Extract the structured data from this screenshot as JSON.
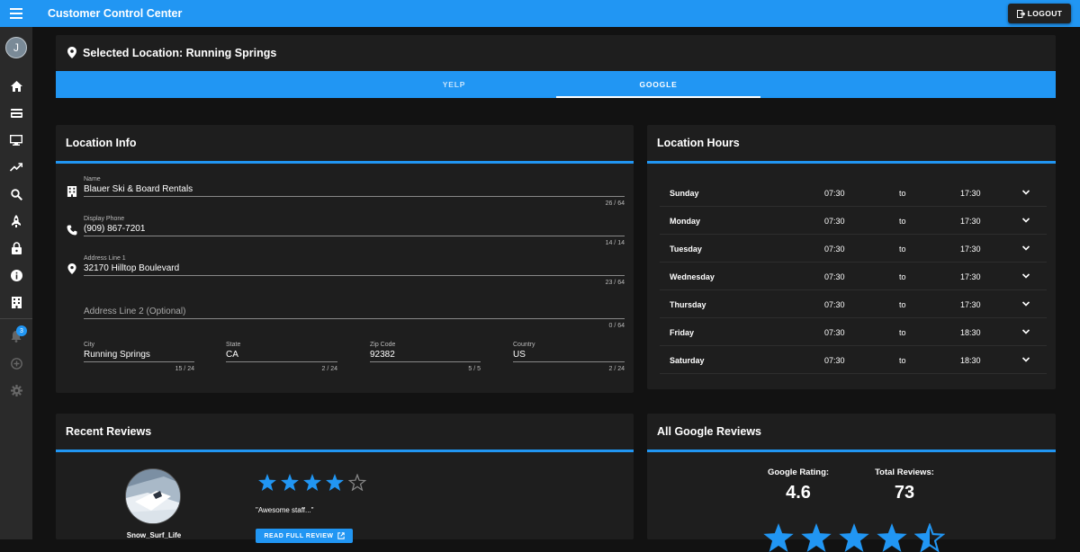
{
  "header": {
    "title": "Customer Control Center",
    "logout_label": "LOGOUT"
  },
  "sidebar": {
    "avatar_initial": "J",
    "notification_count": "3",
    "items": [
      "home-icon",
      "card-icon",
      "monitor-icon",
      "trending-up-icon",
      "search-icon",
      "rocket-icon",
      "lock-icon",
      "info-icon",
      "building-icon",
      "bell-icon",
      "plus-circle-icon",
      "gear-icon"
    ]
  },
  "selected_location": {
    "title": "Selected Location: Running Springs"
  },
  "tabs": [
    {
      "label": "YELP"
    },
    {
      "label": "GOOGLE"
    }
  ],
  "location_info": {
    "title": "Location Info",
    "name": {
      "label": "Name",
      "value": "Blauer Ski & Board Rentals",
      "count": "26 / 64"
    },
    "phone": {
      "label": "Display Phone",
      "value": "(909) 867-7201",
      "count": "14 / 14"
    },
    "address1": {
      "label": "Address Line 1",
      "value": "32170 Hilltop Boulevard",
      "count": "23 / 64"
    },
    "address2": {
      "placeholder": "Address Line 2 (Optional)",
      "count": "0 / 64"
    },
    "city": {
      "label": "City",
      "value": "Running Springs",
      "count": "15 / 24"
    },
    "state": {
      "label": "State",
      "value": "CA",
      "count": "2 / 24"
    },
    "zip": {
      "label": "Zip Code",
      "value": "92382",
      "count": "5 / 5"
    },
    "country": {
      "label": "Country",
      "value": "US",
      "count": "2 / 24"
    }
  },
  "location_hours": {
    "title": "Location Hours",
    "to_label": "to",
    "rows": [
      {
        "day": "Sunday",
        "open": "07:30",
        "close": "17:30"
      },
      {
        "day": "Monday",
        "open": "07:30",
        "close": "17:30"
      },
      {
        "day": "Tuesday",
        "open": "07:30",
        "close": "17:30"
      },
      {
        "day": "Wednesday",
        "open": "07:30",
        "close": "17:30"
      },
      {
        "day": "Thursday",
        "open": "07:30",
        "close": "17:30"
      },
      {
        "day": "Friday",
        "open": "07:30",
        "close": "18:30"
      },
      {
        "day": "Saturday",
        "open": "07:30",
        "close": "18:30"
      }
    ]
  },
  "recent_reviews": {
    "title": "Recent Reviews",
    "reviewer": "Snow_Surf_Life",
    "rating": 4,
    "max_rating": 5,
    "quote": "\"Awesome staff...\"",
    "read_label": "READ FULL REVIEW"
  },
  "google_reviews": {
    "title": "All Google Reviews",
    "rating_label": "Google Rating:",
    "rating_value": "4.6",
    "total_label": "Total Reviews:",
    "total_value": "73",
    "rating": 4.6
  },
  "colors": {
    "accent": "#2196f3",
    "card": "#1e1e1e",
    "background": "#121212",
    "sidebar": "#2a2a2a"
  }
}
